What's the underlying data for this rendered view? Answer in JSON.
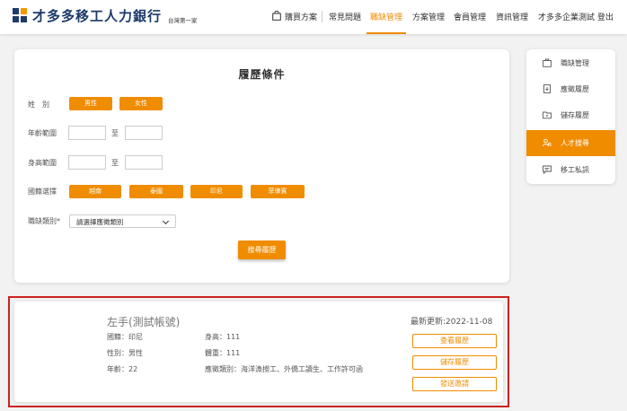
{
  "header": {
    "logo_name": "才多多移工人力銀行",
    "logo_sub": "台灣第一家",
    "nav": [
      {
        "label": "購買方案"
      },
      {
        "label": "常見問題"
      },
      {
        "label": "職缺管理"
      },
      {
        "label": "方案管理"
      },
      {
        "label": "會員管理"
      },
      {
        "label": "資訊管理"
      },
      {
        "label": "才多多企業測試 登出"
      }
    ],
    "active_nav": "職缺管理"
  },
  "search": {
    "title": "履歷條件",
    "gender_label": "姓　別",
    "gender_options": [
      "男性",
      "女性"
    ],
    "age_label": "年齡範圍",
    "height_label": "身高範圍",
    "to_label": "至",
    "age_from": "",
    "age_to": "",
    "height_from": "",
    "height_to": "",
    "nationality_label": "國籍選擇",
    "nationality_options": [
      "越南",
      "泰國",
      "印尼",
      "菲律賓"
    ],
    "category_label": "職缺類別*",
    "category_value": "請選擇應徵類別",
    "search_button": "搜尋履歷"
  },
  "side_menu": {
    "items": [
      {
        "label": "職缺管理",
        "icon": "briefcase-icon"
      },
      {
        "label": "應徵履歷",
        "icon": "document-icon"
      },
      {
        "label": "儲存履歷",
        "icon": "folder-icon"
      },
      {
        "label": "人才搜尋",
        "icon": "people-search-icon"
      },
      {
        "label": "移工私訊",
        "icon": "chat-icon"
      }
    ],
    "active": "人才搜尋"
  },
  "result": {
    "name": "左手(測試帳號)",
    "nationality": "國籍：印尼",
    "gender": "性別：男性",
    "age": "年齡：22",
    "height": "身高：111",
    "weight": "體重：111",
    "job_types": "應徵類別：海洋漁撈工、外僑工讀生、工作許可函",
    "updated": "最新更新:2022-11-08",
    "view_button": "查看履歷",
    "save_button": "儲存履歷",
    "invite_button": "發送邀請"
  },
  "colors": {
    "accent": "#f08c00",
    "brand": "#1d3a6b",
    "highlight_border": "#cc2222"
  }
}
